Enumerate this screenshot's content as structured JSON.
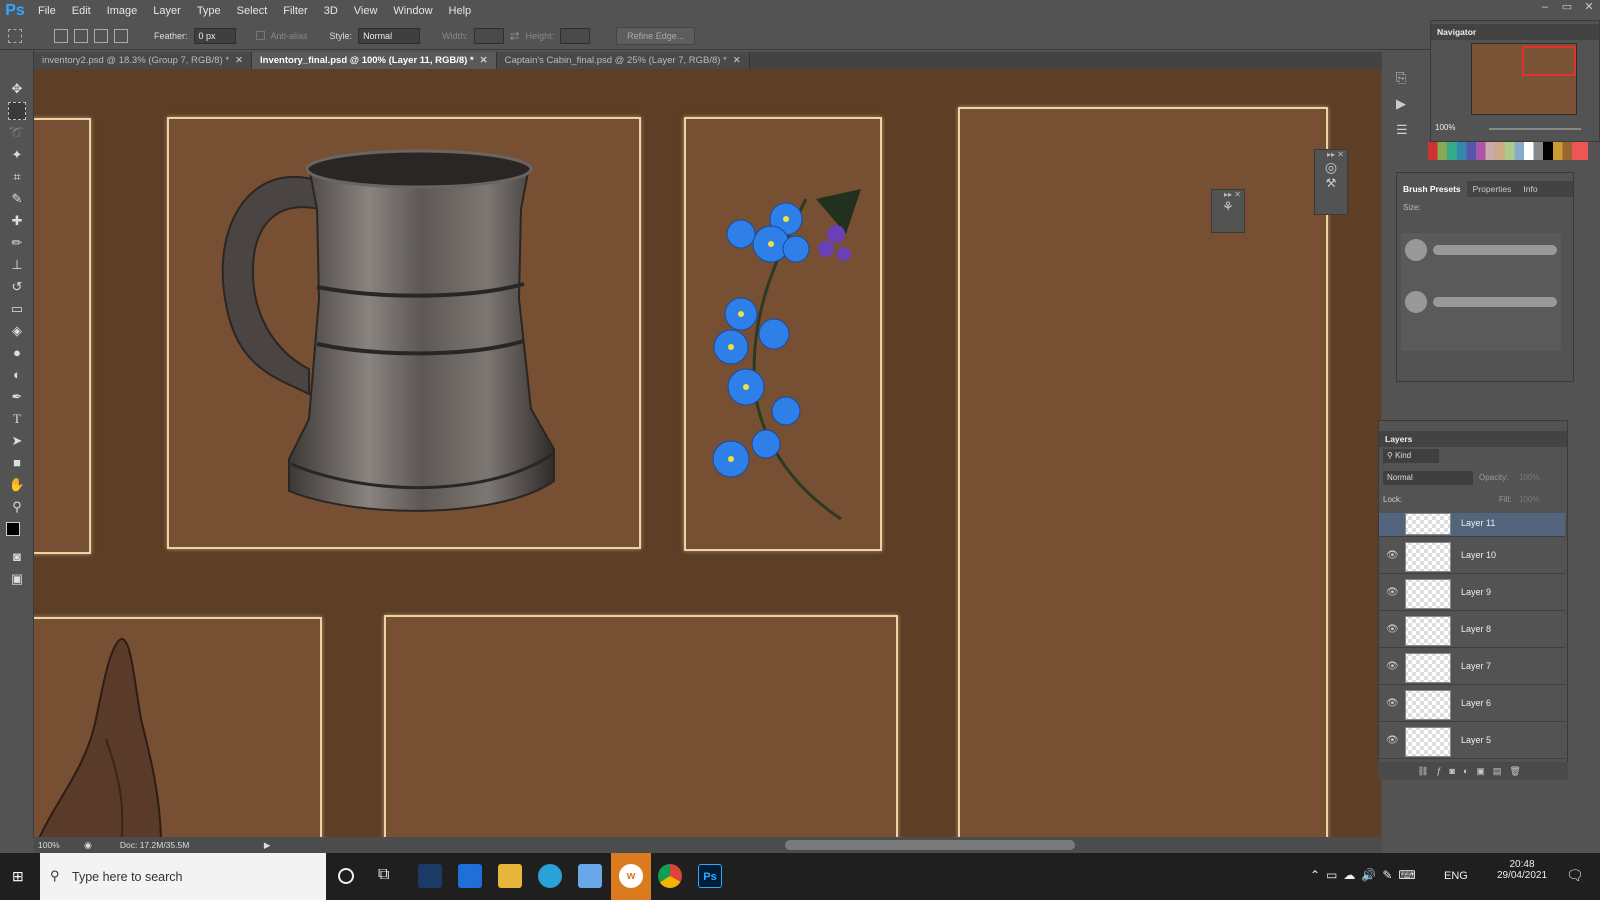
{
  "app": {
    "logo": "Ps"
  },
  "menu": [
    "File",
    "Edit",
    "Image",
    "Layer",
    "Type",
    "Select",
    "Filter",
    "3D",
    "View",
    "Window",
    "Help"
  ],
  "window_controls": {
    "minimize": "–",
    "restore": "▭",
    "close": "✕"
  },
  "options": {
    "feather_label": "Feather:",
    "feather_value": "0 px",
    "antialias_label": "Anti-alias",
    "style_label": "Style:",
    "style_value": "Normal",
    "width_label": "Width:",
    "height_label": "Height:",
    "refine_edge": "Refine Edge..."
  },
  "tabs": [
    {
      "label": "inventory2.psd @ 18.3% (Group 7, RGB/8) *",
      "active": false
    },
    {
      "label": "Inventory_final.psd @ 100% (Layer 11, RGB/8) *",
      "active": true
    },
    {
      "label": "Captain's Cabin_final.psd @ 25% (Layer 7, RGB/8) *",
      "active": false
    }
  ],
  "status": {
    "zoom": "100%",
    "doc": "Doc: 17.2M/35.5M"
  },
  "navigator": {
    "title": "Navigator",
    "zoom": "100%"
  },
  "brush_panel": {
    "tabs": [
      "Brush Presets",
      "Properties",
      "Info"
    ],
    "size_label": "Size:"
  },
  "layers_panel": {
    "title": "Layers",
    "kind_label": "Kind",
    "blend_mode": "Normal",
    "opacity_label": "Opacity:",
    "opacity_value": "100%",
    "lock_label": "Lock:",
    "fill_label": "Fill:",
    "fill_value": "100%",
    "layers": [
      {
        "name": "Layer 11",
        "selected": true
      },
      {
        "name": "Layer 10",
        "selected": false
      },
      {
        "name": "Layer 9",
        "selected": false
      },
      {
        "name": "Layer 8",
        "selected": false
      },
      {
        "name": "Layer 7",
        "selected": false
      },
      {
        "name": "Layer 6",
        "selected": false
      },
      {
        "name": "Layer 5",
        "selected": false
      }
    ]
  },
  "taskbar": {
    "search_placeholder": "Type here to search",
    "language": "ENG",
    "time": "20:48",
    "date": "29/04/2021"
  },
  "colors": {
    "canvas_bg": "#5e3e25",
    "panel_bg": "#775034",
    "panel_border": "#e9d5a4",
    "ps_blue": "#31a8ff"
  }
}
